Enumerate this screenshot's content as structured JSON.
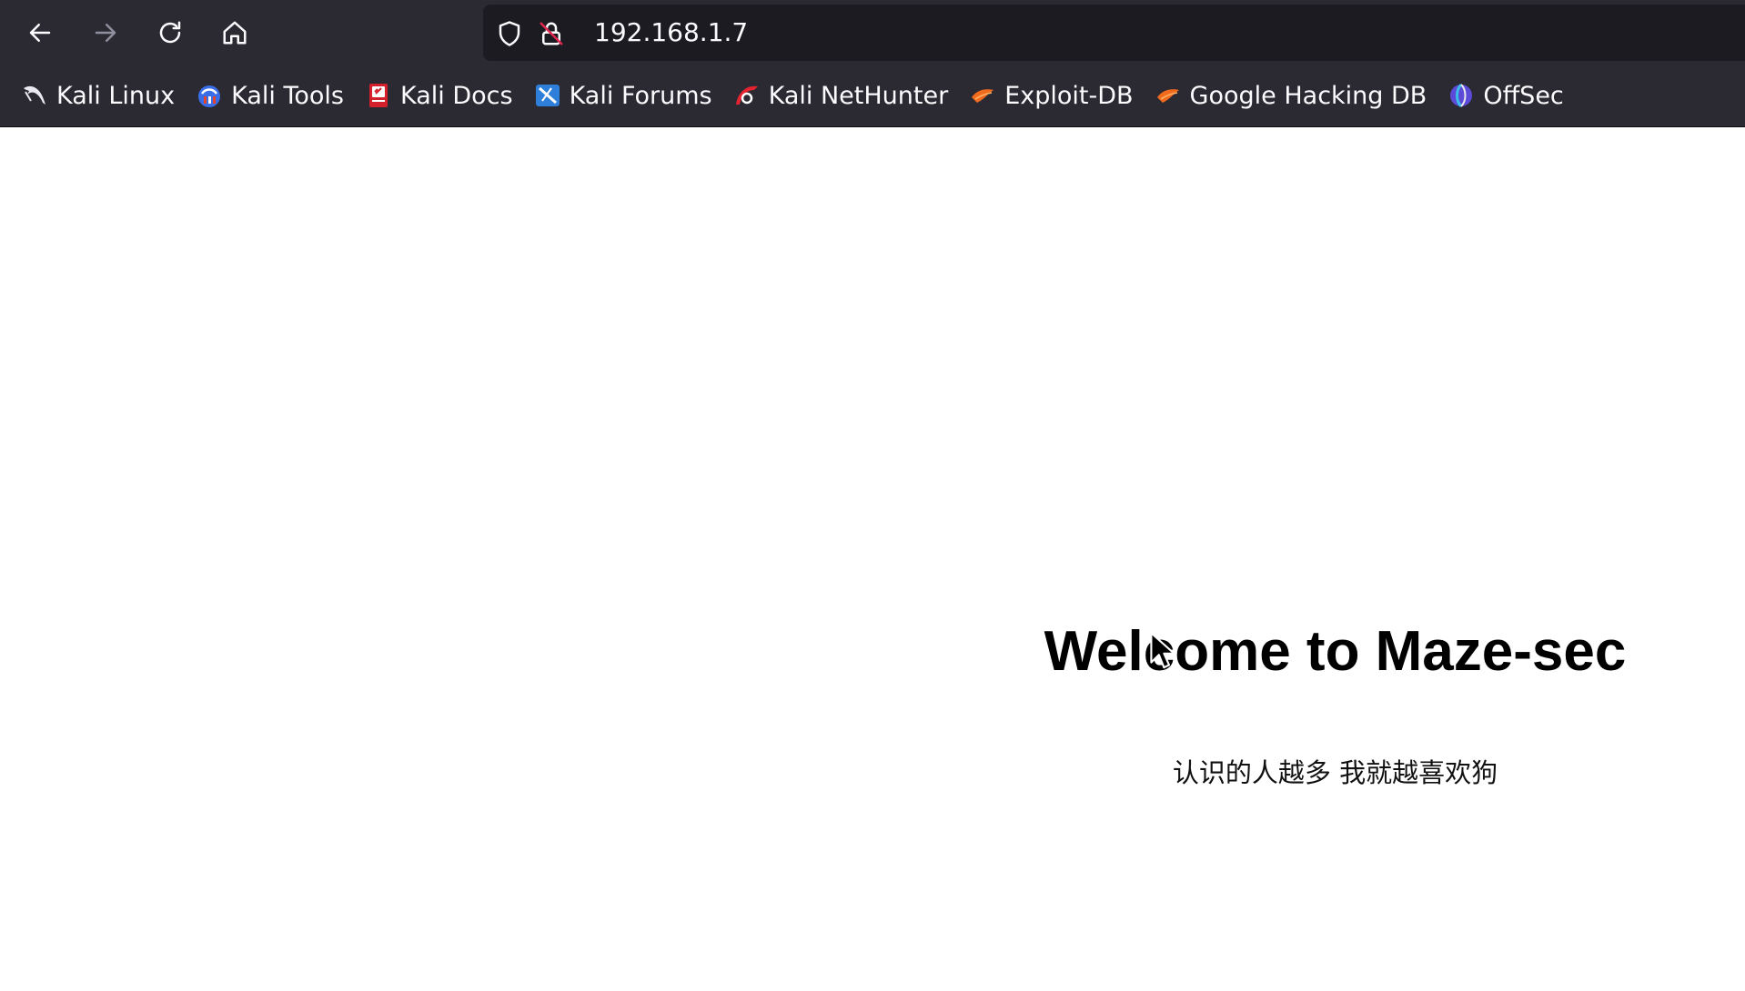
{
  "browser": {
    "url": "192.168.1.7",
    "colors": {
      "chrome": "#2b2a33",
      "urlbar": "#1c1b22",
      "text": "#fbfbfe"
    }
  },
  "bookmarks": [
    {
      "label": "Kali Linux",
      "icon": "kali-dragon-icon"
    },
    {
      "label": "Kali Tools",
      "icon": "kali-tools-icon"
    },
    {
      "label": "Kali Docs",
      "icon": "kali-docs-icon"
    },
    {
      "label": "Kali Forums",
      "icon": "kali-forums-icon"
    },
    {
      "label": "Kali NetHunter",
      "icon": "kali-nethunter-icon"
    },
    {
      "label": "Exploit-DB",
      "icon": "exploit-db-icon"
    },
    {
      "label": "Google Hacking DB",
      "icon": "google-hacking-db-icon"
    },
    {
      "label": "OffSec",
      "icon": "offsec-icon"
    }
  ],
  "page": {
    "title": "Welcome to Maze-sec",
    "subtitle": "认识的人越多 我就越喜欢狗"
  }
}
